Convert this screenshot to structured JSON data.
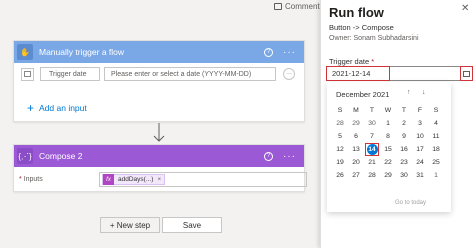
{
  "header": {
    "comments_label": "Comments"
  },
  "trigger": {
    "title": "Manually trigger a flow",
    "input_label": "Trigger date",
    "input_placeholder": "Please enter or select a date (YYYY-MM-DD)",
    "add_input_label": "Add an input"
  },
  "compose": {
    "title": "Compose 2",
    "inputs_label": "Inputs",
    "required_mark": "*",
    "token_label": "addDays(...)",
    "token_icon": "fx"
  },
  "buttons": {
    "new_step": "+ New step",
    "save": "Save"
  },
  "panel": {
    "title": "Run flow",
    "flow_name": "Button -> Compose",
    "owner": "Owner: Sonam Subhadarsini",
    "field_label": "Trigger date",
    "required_mark": "*",
    "field_value": "2021-12-14",
    "calendar": {
      "month_label": "December 2021",
      "weekdays": [
        "S",
        "M",
        "T",
        "W",
        "T",
        "F",
        "S"
      ],
      "weeks": [
        [
          "28",
          "29",
          "30",
          "1",
          "2",
          "3",
          "4"
        ],
        [
          "5",
          "6",
          "7",
          "8",
          "9",
          "10",
          "11"
        ],
        [
          "12",
          "13",
          "14",
          "15",
          "16",
          "17",
          "18"
        ],
        [
          "19",
          "20",
          "21",
          "22",
          "23",
          "24",
          "25"
        ],
        [
          "26",
          "27",
          "28",
          "29",
          "30",
          "31",
          "1"
        ]
      ],
      "selected_day": "14",
      "go_to_today": "Go to today"
    }
  },
  "colors": {
    "trigger_header": "#7aa7e6",
    "compose_header": "#9b59d6",
    "accent_blue": "#0078d4",
    "highlight_red": "#d13438"
  }
}
